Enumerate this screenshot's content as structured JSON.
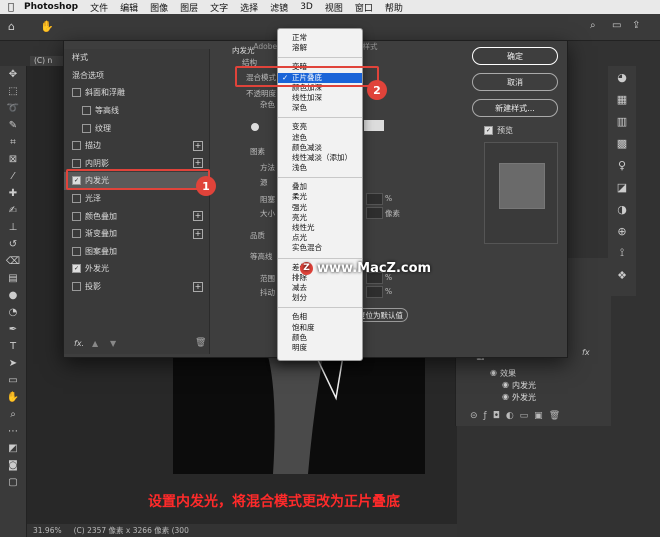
{
  "menubar": {
    "apple": "",
    "app": "Photoshop",
    "items": [
      "文件",
      "编辑",
      "图像",
      "图层",
      "文字",
      "选择",
      "滤镜",
      "3D",
      "视图",
      "窗口",
      "帮助"
    ]
  },
  "doc_tab": "(C) n",
  "dialog": {
    "title": "Adobe Photoshop 2020 · 图层样式",
    "styles_header": "样式",
    "blend_options": "混合选项",
    "items": [
      {
        "label": "斜面和浮雕",
        "checked": false,
        "plus": false
      },
      {
        "label": "等高线",
        "checked": false,
        "plus": false
      },
      {
        "label": "纹理",
        "checked": false,
        "plus": false
      },
      {
        "label": "描边",
        "checked": false,
        "plus": true
      },
      {
        "label": "内阴影",
        "checked": false,
        "plus": true
      },
      {
        "label": "内发光",
        "checked": true,
        "plus": false
      },
      {
        "label": "光泽",
        "checked": false,
        "plus": false
      },
      {
        "label": "颜色叠加",
        "checked": false,
        "plus": true
      },
      {
        "label": "渐变叠加",
        "checked": false,
        "plus": true
      },
      {
        "label": "图案叠加",
        "checked": false,
        "plus": false
      },
      {
        "label": "外发光",
        "checked": true,
        "plus": false
      },
      {
        "label": "投影",
        "checked": false,
        "plus": true
      }
    ],
    "fx": "fx.",
    "section_title": "内发光",
    "structure": "结构",
    "blend_mode_label": "混合模式",
    "opacity_label": "不透明度",
    "noise_label": "杂色",
    "elements": "图素",
    "method": "方法",
    "source": "源",
    "choke": "阻塞",
    "size": "大小",
    "size_unit": "像素",
    "pct": "%",
    "quality": "品质",
    "contour": "等高线",
    "range": "范围",
    "jitter": "抖动",
    "reset_default": "复位为默认值",
    "buttons": {
      "ok": "确定",
      "cancel": "取消",
      "new_style": "新建样式...",
      "preview": "预览"
    }
  },
  "dropdown": {
    "groups": [
      [
        "正常",
        "溶解"
      ],
      [
        "变暗",
        "正片叠底",
        "颜色加深",
        "线性加深",
        "深色"
      ],
      [
        "变亮",
        "滤色",
        "颜色减淡",
        "线性减淡（添加）",
        "浅色"
      ],
      [
        "叠加",
        "柔光",
        "强光",
        "亮光",
        "线性光",
        "点光",
        "实色混合"
      ],
      [
        "差值",
        "排除",
        "减去",
        "划分"
      ],
      [
        "色相",
        "饱和度",
        "颜色",
        "明度"
      ]
    ],
    "selected": "正片叠底"
  },
  "layers": {
    "fx": "fx",
    "effects": "效果",
    "inner_glow": "内发光",
    "outer_glow": "外发光"
  },
  "status": {
    "zoom": "31.96%",
    "info": "(C) 2357 像素 x 3266 像素 (300"
  },
  "annotations": {
    "badge1": "1",
    "badge2": "2"
  },
  "watermark": "www.MacZ.com",
  "watermark_icon": "Z",
  "caption": "设置内发光，将混合模式更改为正片叠底",
  "colors": {
    "accent": "#e0433a",
    "selection": "#1a64d8"
  }
}
